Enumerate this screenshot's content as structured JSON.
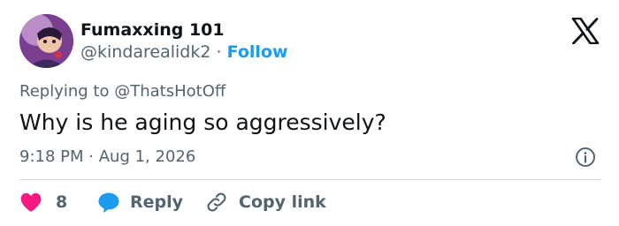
{
  "user": {
    "display_name": "Fumaxxing 101",
    "handle": "@kindarealidk2",
    "separator": "·",
    "follow_label": "Follow"
  },
  "reply_context": {
    "prefix": "Replying to",
    "mention": "@ThatsHotOff"
  },
  "tweet": {
    "text": "Why is he aging so aggressively?",
    "time": "9:18 PM",
    "separator": "·",
    "date": "Aug 1, 2026"
  },
  "actions": {
    "like_count": "8",
    "reply_label": "Reply",
    "copy_link_label": "Copy link"
  },
  "icons": {
    "brand": "x-logo-icon",
    "info": "info-icon",
    "like": "heart-icon",
    "reply": "speech-bubble-icon",
    "copy": "link-icon"
  },
  "colors": {
    "accent": "#1d9bf0",
    "like": "#f91880",
    "text": "#0f1419",
    "muted": "#536471"
  }
}
